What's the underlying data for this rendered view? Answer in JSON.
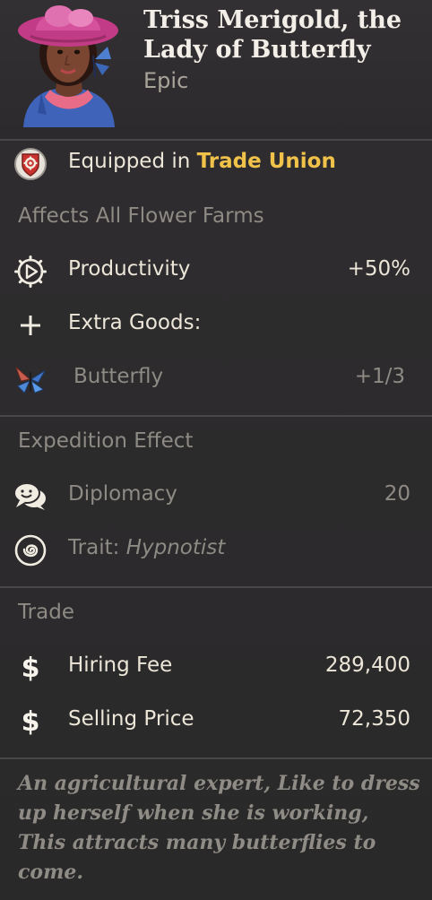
{
  "header": {
    "title": "Triss Merigold, the Lady of Butterfly",
    "rarity": "Epic",
    "portrait_icon": "hero-portrait-icon"
  },
  "equip": {
    "prefix": "Equipped in ",
    "building": "Trade Union",
    "icon": "shield-gear-icon"
  },
  "affects": {
    "title": "Affects All Flower Farms",
    "productivity_label": "Productivity",
    "productivity_value": "+50%",
    "extra_goods_label": "Extra Goods:",
    "goods": [
      {
        "name": "Butterfly",
        "value": "+1/3",
        "icon": "butterfly-icon"
      }
    ]
  },
  "expedition": {
    "title": "Expedition Effect",
    "diplomacy_label": "Diplomacy",
    "diplomacy_value": "20",
    "trait_label": "Trait: ",
    "trait_value": "Hypnotist"
  },
  "trade": {
    "title": "Trade",
    "hiring_fee_label": "Hiring Fee",
    "hiring_fee_value": "289,400",
    "selling_price_label": "Selling Price",
    "selling_price_value": "72,350",
    "currency_symbol": "$"
  },
  "description": "An agricultural expert, Like to dress up herself when she is working, This attracts many butterflies to come.",
  "colors": {
    "accent_gold": "#f0c24a",
    "text": "#ece6d8",
    "muted": "#8e8a84",
    "background": "#2b2a2b"
  }
}
